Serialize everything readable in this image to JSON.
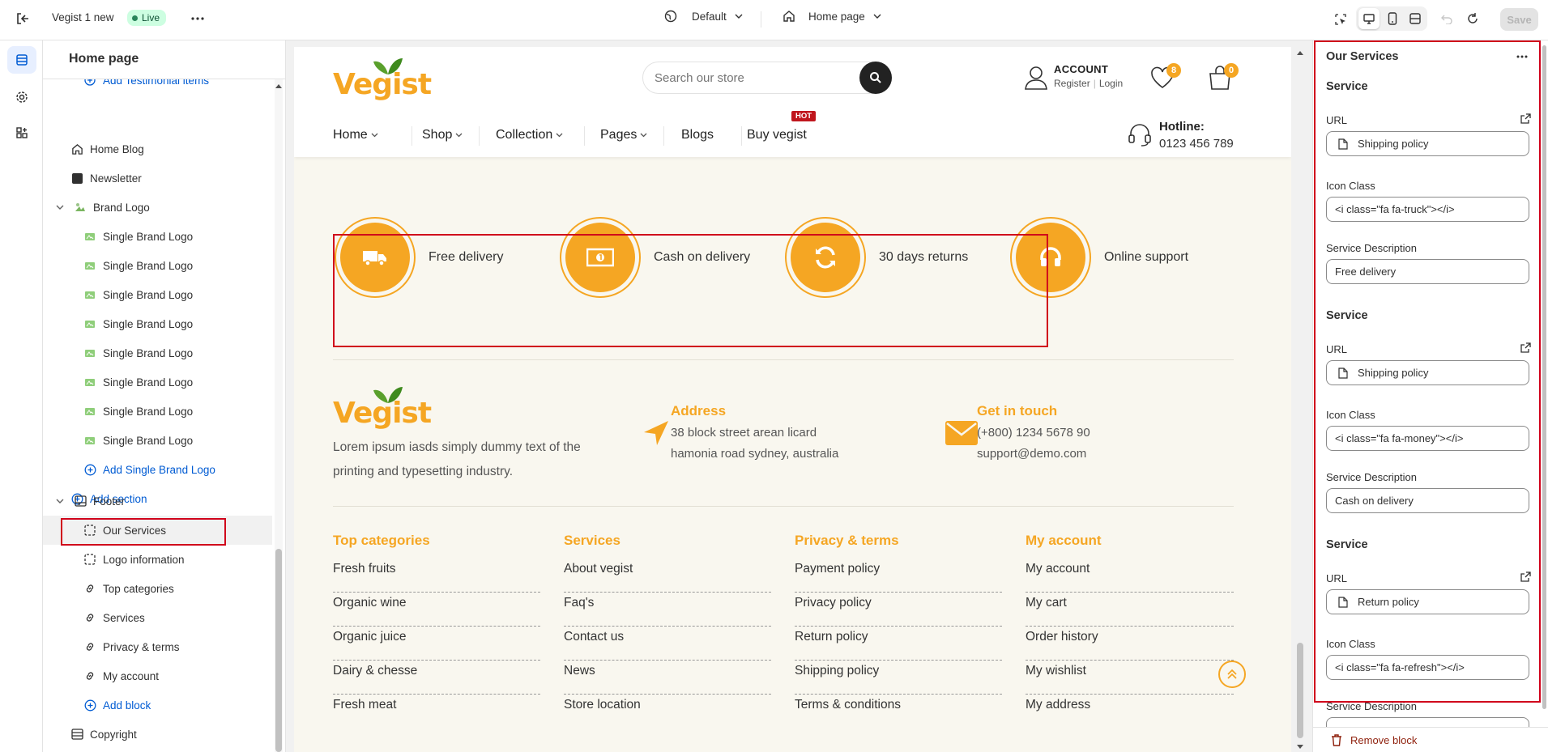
{
  "topbar": {
    "store_name": "Vegist 1 new",
    "status": "Live",
    "theme_select": "Default",
    "page_select": "Home page",
    "save_label": "Save"
  },
  "left_panel": {
    "title": "Home page",
    "partial_item": "Add Testimonial items",
    "items": [
      {
        "label": "Home Blog",
        "icon": "home-icon",
        "level": 0
      },
      {
        "label": "Newsletter",
        "icon": "newsletter-icon",
        "level": 0
      },
      {
        "label": "Brand Logo",
        "icon": "brand-logo-icon",
        "level": 0
      },
      {
        "label": "Single Brand Logo",
        "icon": "brand-thumb-icon",
        "level": 1
      },
      {
        "label": "Single Brand Logo",
        "icon": "brand-thumb-icon",
        "level": 1
      },
      {
        "label": "Single Brand Logo",
        "icon": "brand-thumb-icon",
        "level": 1
      },
      {
        "label": "Single Brand Logo",
        "icon": "brand-thumb-icon",
        "level": 1
      },
      {
        "label": "Single Brand Logo",
        "icon": "brand-thumb-icon",
        "level": 1
      },
      {
        "label": "Single Brand Logo",
        "icon": "brand-thumb-icon",
        "level": 1
      },
      {
        "label": "Single Brand Logo",
        "icon": "brand-thumb-icon",
        "level": 1
      },
      {
        "label": "Single Brand Logo",
        "icon": "brand-thumb-icon",
        "level": 1
      },
      {
        "label": "Add Single Brand Logo",
        "icon": "plus-circle-icon",
        "level": 1
      },
      {
        "label": "Add section",
        "icon": "plus-circle-icon",
        "level": 0
      }
    ],
    "footer_group": "Footer",
    "footer_items": [
      {
        "label": "Our Services",
        "icon": "block-icon"
      },
      {
        "label": "Logo information",
        "icon": "block-icon"
      },
      {
        "label": "Top categories",
        "icon": "link-icon"
      },
      {
        "label": "Services",
        "icon": "link-icon"
      },
      {
        "label": "Privacy & terms",
        "icon": "link-icon"
      },
      {
        "label": "My account",
        "icon": "link-icon"
      },
      {
        "label": "Add block",
        "icon": "plus-circle-icon"
      }
    ],
    "copyright": "Copyright"
  },
  "site": {
    "logo_text": "Vegist",
    "search_placeholder": "Search our store",
    "account_title": "ACCOUNT",
    "register": "Register",
    "login": "Login",
    "wishlist_count": "8",
    "cart_count": "0",
    "nav": [
      "Home",
      "Shop",
      "Collection",
      "Pages",
      "Blogs",
      "Buy vegist"
    ],
    "hot_badge": "HOT",
    "hotline_label": "Hotline:",
    "hotline_number": "0123 456 789",
    "services": [
      {
        "label": "Free delivery",
        "icon": "truck-icon"
      },
      {
        "label": "Cash on delivery",
        "icon": "money-icon"
      },
      {
        "label": "30 days returns",
        "icon": "refresh-icon"
      },
      {
        "label": "Online support",
        "icon": "headset-icon"
      }
    ],
    "about_text": "Lorem ipsum iasds simply dummy text of the printing and typesetting industry.",
    "address_title": "Address",
    "address_line1": "38 block street arean licard",
    "address_line2": "hamonia road sydney, australia",
    "contact_title": "Get in touch",
    "phone": "(+800) 1234 5678 90",
    "email": "support@demo.com",
    "footer_cols": [
      {
        "title": "Top categories",
        "links": [
          "Fresh fruits",
          "Organic wine",
          "Organic juice",
          "Dairy & chesse",
          "Fresh meat"
        ]
      },
      {
        "title": "Services",
        "links": [
          "About vegist",
          "Faq's",
          "Contact us",
          "News",
          "Store location"
        ]
      },
      {
        "title": "Privacy & terms",
        "links": [
          "Payment policy",
          "Privacy policy",
          "Return policy",
          "Shipping policy",
          "Terms & conditions"
        ]
      },
      {
        "title": "My account",
        "links": [
          "My account",
          "My cart",
          "Order history",
          "My wishlist",
          "My address"
        ]
      }
    ]
  },
  "right_panel": {
    "title": "Our Services",
    "service_heading": "Service",
    "url_label": "URL",
    "icon_class_label": "Icon Class",
    "desc_label": "Service Description",
    "services": [
      {
        "url": "Shipping policy",
        "icon_class": "<i class=\"fa fa-truck\"></i>",
        "desc": "Free delivery"
      },
      {
        "url": "Shipping policy",
        "icon_class": "<i class=\"fa fa-money\"></i>",
        "desc": "Cash on delivery"
      },
      {
        "url": "Return policy",
        "icon_class": "<i class=\"fa fa-refresh\"></i>",
        "desc": ""
      }
    ],
    "remove_block": "Remove block"
  },
  "colors": {
    "accent": "#f5a623",
    "logo_green": "#5aa02c",
    "highlight": "#d0021b",
    "link_blue": "#005bd3",
    "live_green": "#29845a"
  }
}
